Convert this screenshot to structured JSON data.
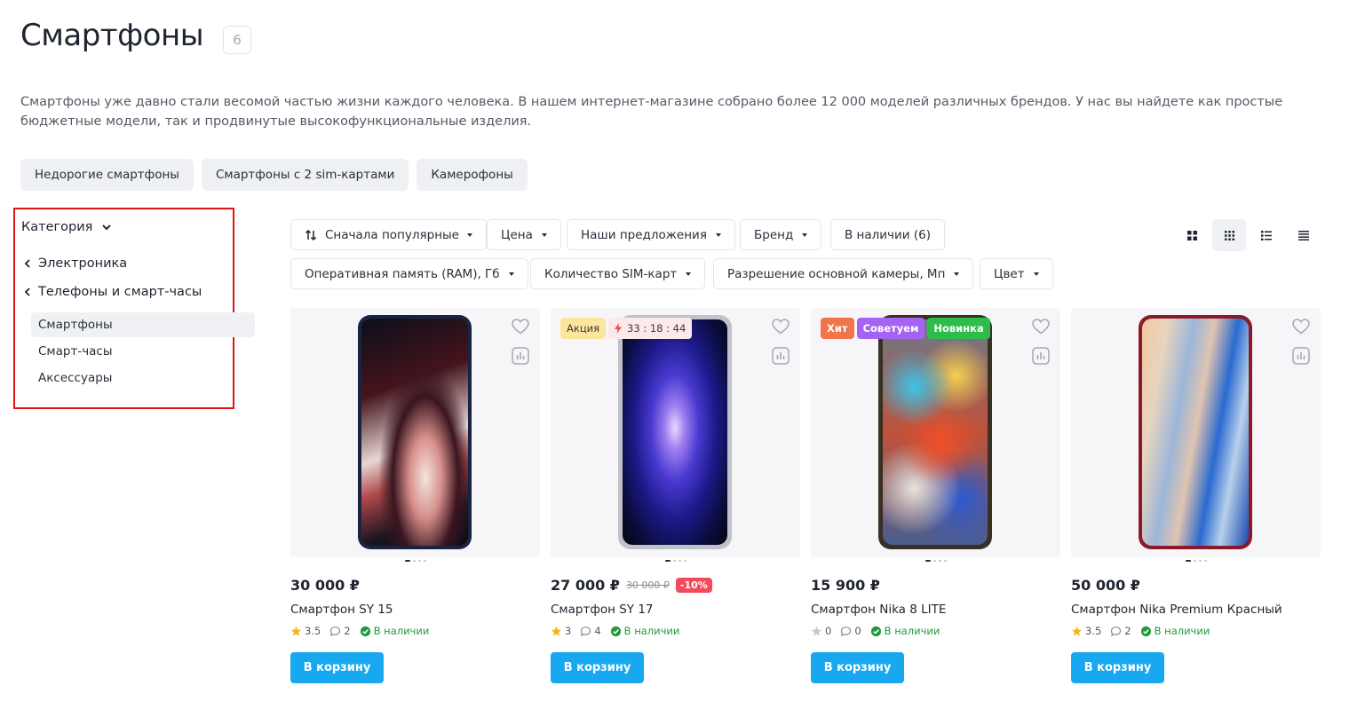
{
  "header": {
    "title": "Смартфоны",
    "count": "6"
  },
  "description": "Смартфоны уже давно стали весомой частью жизни каждого человека. В нашем интернет-магазине собрано более 12 000 моделей различных брендов. У нас вы найдете как простые бюджетные модели, так и продвинутые высокофункциональные изделия.",
  "tags": [
    "Недорогие смартфоны",
    "Смартфоны с 2 sim-картами",
    "Камерофоны"
  ],
  "sidebar": {
    "header": "Категория",
    "parents": [
      "Электроника",
      "Телефоны и смарт-часы"
    ],
    "items": [
      "Смартфоны",
      "Смарт-часы",
      "Аксессуары"
    ],
    "active_item": "Смартфоны"
  },
  "filters": {
    "sort": "Сначала популярные",
    "price": "Цена",
    "offers": "Наши предложения",
    "brand": "Бренд",
    "in_stock": "В наличии (6)",
    "ram": "Оперативная память (RAM), Гб",
    "sim": "Количество SIM-карт",
    "camera": "Разрешение основной камеры, Мп",
    "color": "Цвет"
  },
  "view_modes": [
    "grid-large-icon",
    "grid-small-icon",
    "list-icon",
    "table-icon"
  ],
  "products": [
    {
      "price": "30 000 ₽",
      "name": "Смартфон SY 15",
      "rating": "3.5",
      "comments": "2",
      "stock": "В наличии",
      "cart": "В корзину",
      "image": "phone-image-1"
    },
    {
      "price": "27 000 ₽",
      "old_price": "30 000 ₽",
      "discount": "-10%",
      "name": "Смартфон SY 17",
      "rating": "3",
      "comments": "4",
      "stock": "В наличии",
      "cart": "В корзину",
      "badge_sale": "Акция",
      "timer": "33 : 18 : 44",
      "image": "phone-image-2"
    },
    {
      "price": "15 900 ₽",
      "name": "Смартфон Nika 8 LITE",
      "rating": "0",
      "comments": "0",
      "stock": "В наличии",
      "cart": "В корзину",
      "badges": [
        "Хит",
        "Советуем",
        "Новинка"
      ],
      "image": "phone-image-3"
    },
    {
      "price": "50 000 ₽",
      "name": "Смартфон Nika Premium Красный",
      "rating": "3.5",
      "comments": "2",
      "stock": "В наличии",
      "cart": "В корзину",
      "image": "phone-image-4"
    }
  ],
  "colors": {
    "cart_button": "#18a8f0",
    "in_stock": "#1f9a3a",
    "discount": "#f04a5b",
    "highlight_border": "#e01414"
  }
}
